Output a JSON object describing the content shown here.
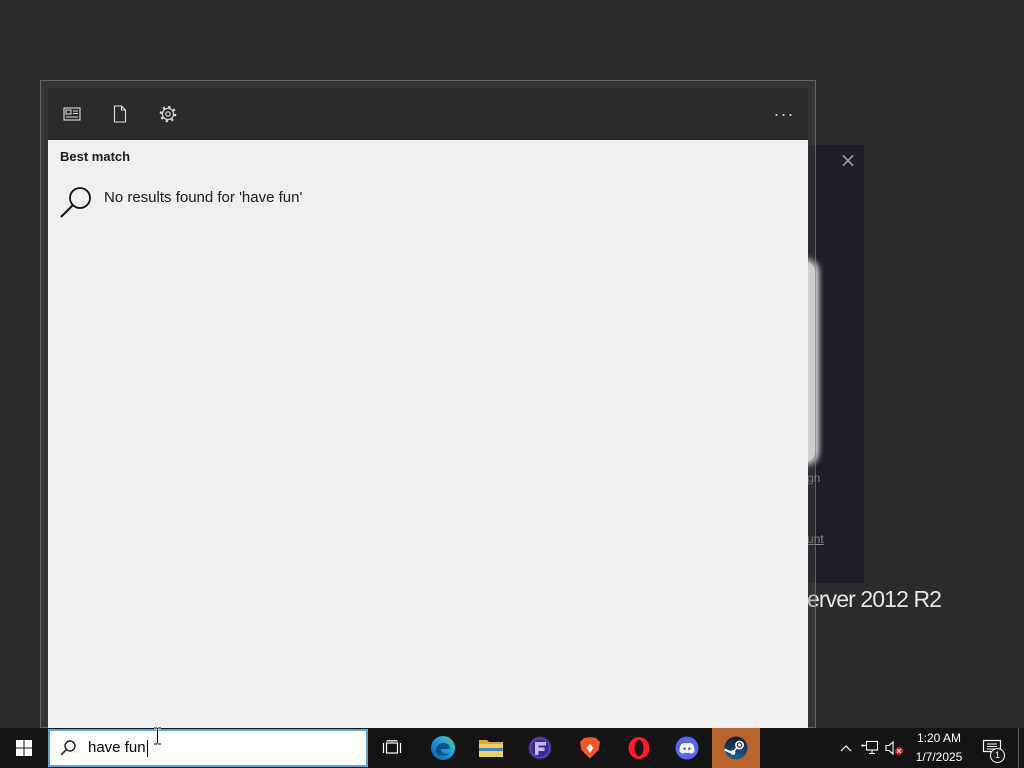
{
  "colors": {
    "desktop_bg": "#2b2b2b",
    "panel_toolbar_bg": "#2b2b2b",
    "panel_content_bg": "#f0f0f0",
    "taskbar_bg": "#141414",
    "search_border": "#5aa5e2",
    "flashing_button_bg": "#b8642c",
    "background_window_bg": "#1e1e28"
  },
  "background_window": {
    "close_label": "×",
    "text_fragment_1": "gn",
    "text_fragment_2": "unt"
  },
  "desktop": {
    "wallpaper_text": "erver 2012 R2"
  },
  "search_panel": {
    "toolbar": {
      "filters": [
        {
          "icon": "apps-filter-icon"
        },
        {
          "icon": "documents-filter-icon"
        },
        {
          "icon": "settings-gear-icon"
        }
      ],
      "more_label": "···"
    },
    "section_title": "Best match",
    "result": {
      "icon": "search-icon",
      "text": "No results found for 'have fun'"
    }
  },
  "taskbar": {
    "start_icon": "windows-logo-icon",
    "search_box": {
      "icon": "search-icon",
      "value": "have fun"
    },
    "task_view_icon": "task-view-icon",
    "pinned_apps": [
      {
        "icon": "edge-icon"
      },
      {
        "icon": "file-explorer-icon"
      },
      {
        "icon": "purple-f-app-icon"
      },
      {
        "icon": "brave-icon"
      },
      {
        "icon": "opera-icon"
      },
      {
        "icon": "discord-icon"
      },
      {
        "icon": "steam-icon",
        "flashing": true
      }
    ],
    "tray": {
      "icons": [
        "chevron-up-icon",
        "network-icon",
        "volume-muted-icon"
      ],
      "clock_time": "1:20 AM",
      "clock_date": "1/7/2025",
      "notification_icon": "action-center-icon",
      "notification_count": "1"
    }
  }
}
